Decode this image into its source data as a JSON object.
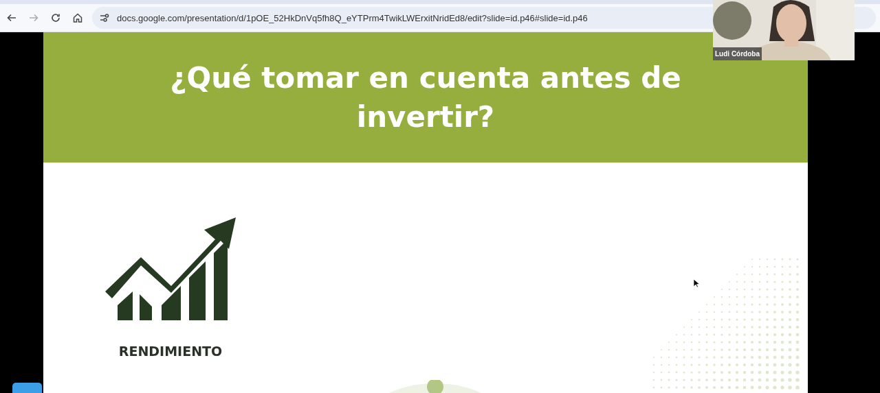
{
  "browser": {
    "url": "docs.google.com/presentation/d/1pOE_52HkDnVq5fh8Q_eYTPrm4TwikLWErxitNridEd8/edit?slide=id.p46#slide=id.p46"
  },
  "slide": {
    "title": "¿Qué tomar en cuenta antes de invertir?",
    "items": [
      {
        "label": "RENDIMIENTO"
      }
    ]
  },
  "video_tile": {
    "name": "Ludi Córdoba",
    "kind": "picture"
  }
}
